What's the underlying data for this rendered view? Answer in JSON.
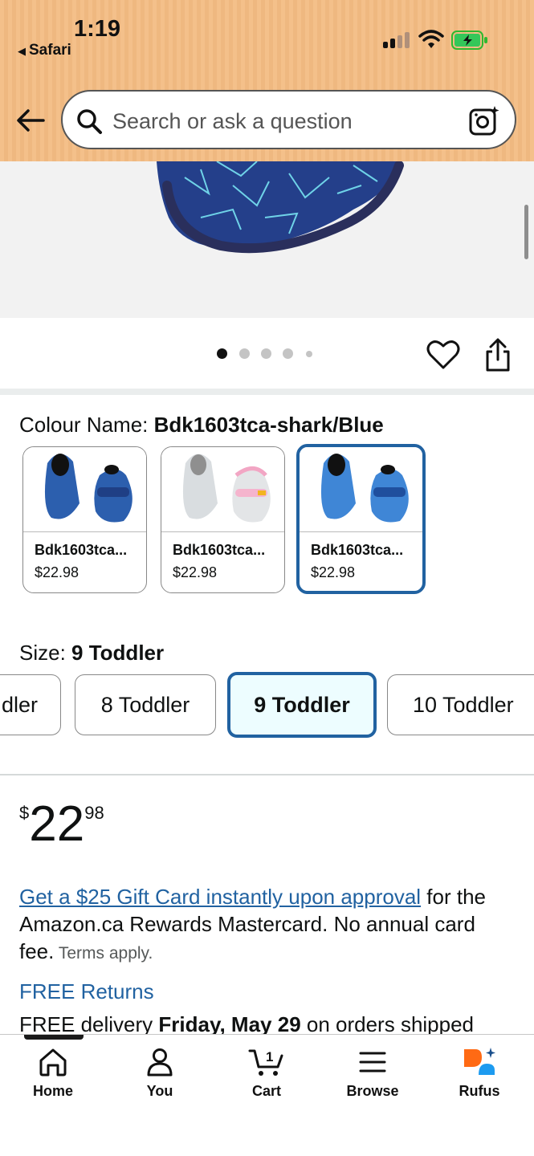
{
  "status_bar": {
    "time": "1:19",
    "back_app": "Safari"
  },
  "header": {
    "search_placeholder": "Search or ask a question"
  },
  "colors": {
    "header_bg": "#f4c08a",
    "link_blue": "#2162a1",
    "selected_border": "#2162a1",
    "rufus_orange": "#ff6a14",
    "rufus_blue": "#1d9bf0"
  },
  "image_carousel": {
    "dot_count": 5,
    "active_index": 0
  },
  "colour": {
    "label": "Colour Name: ",
    "selected_value": "Bdk1603tca-shark/Blue",
    "options": [
      {
        "name": "Bdk1603tca...",
        "price": "$22.98"
      },
      {
        "name": "Bdk1603tca...",
        "price": "$22.98"
      },
      {
        "name": "Bdk1603tca...",
        "price": "$22.98"
      }
    ]
  },
  "size": {
    "label": "Size: ",
    "selected_value": "9 Toddler",
    "options": [
      "dler",
      "8 Toddler",
      "9 Toddler",
      "10 Toddler"
    ]
  },
  "price": {
    "symbol": "$",
    "whole": "22",
    "fraction": "98"
  },
  "offer": {
    "link_text": "Get a $25 Gift Card instantly upon approval",
    "text": " for the Amazon.ca Rewards Mastercard. No annual card fee.",
    "terms": " Terms apply."
  },
  "free_returns": "FREE Returns",
  "delivery": {
    "prefix": "FREE delivery ",
    "date": "Friday, May 29",
    "suffix": " on orders shipped"
  },
  "tabbar": {
    "items": [
      {
        "label": "Home",
        "icon": "home-icon"
      },
      {
        "label": "You",
        "icon": "person-icon"
      },
      {
        "label": "Cart",
        "icon": "cart-icon",
        "badge": "1"
      },
      {
        "label": "Browse",
        "icon": "menu-icon"
      },
      {
        "label": "Rufus",
        "icon": "rufus-icon"
      }
    ]
  }
}
